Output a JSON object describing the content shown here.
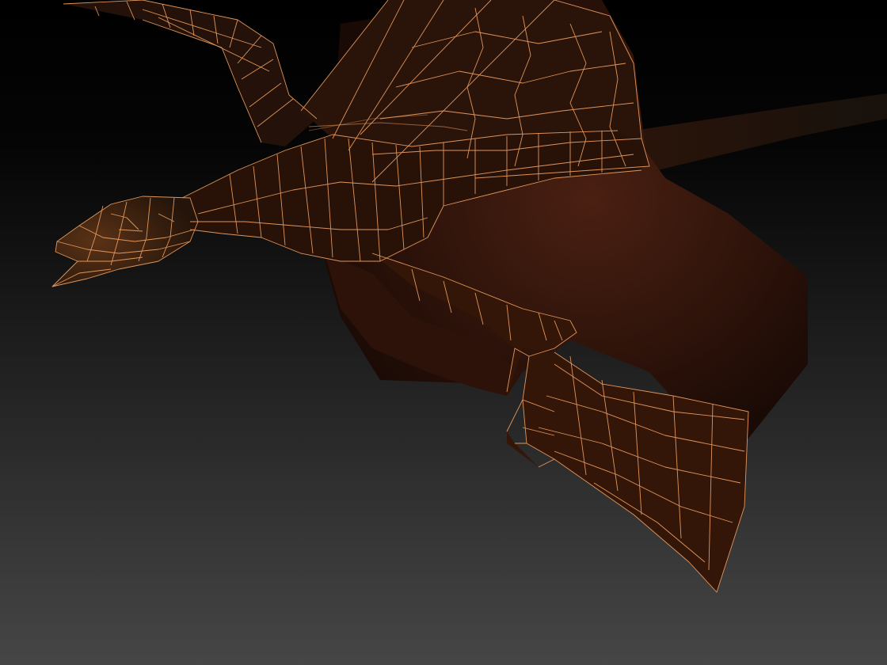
{
  "viewport": {
    "mode": "wireframe-on-shaded",
    "subject": "dragon-model",
    "colors": {
      "wire": "#f0a060",
      "skin_dark": "#1e0e06",
      "skin_mid": "#3a1a0e",
      "skin_light": "#4a2012",
      "tail": "#2a140a",
      "bg_top": "#000000",
      "bg_bottom": "#444444"
    }
  }
}
